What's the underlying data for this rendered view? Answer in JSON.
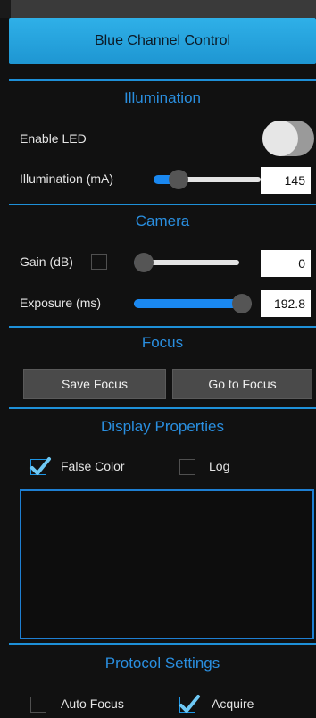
{
  "header": {
    "title": "Blue Channel Control"
  },
  "illumination": {
    "section_title": "Illumination",
    "enable_led_label": "Enable LED",
    "enable_led_on": false,
    "illumination_label": "Illumination (mA)",
    "illumination_value": "145",
    "illumination_slider_fraction": 0.23
  },
  "camera": {
    "section_title": "Camera",
    "gain_label": "Gain (dB)",
    "gain_checked": false,
    "gain_value": "0",
    "gain_slider_fraction": 0.0,
    "exposure_label": "Exposure (ms)",
    "exposure_value": "192.8",
    "exposure_slider_fraction": 1.0
  },
  "focus": {
    "section_title": "Focus",
    "save_focus_label": "Save Focus",
    "go_to_focus_label": "Go to Focus"
  },
  "display": {
    "section_title": "Display Properties",
    "false_color_label": "False Color",
    "false_color_checked": true,
    "log_label": "Log",
    "log_checked": false
  },
  "protocol": {
    "section_title": "Protocol Settings",
    "auto_focus_label": "Auto Focus",
    "auto_focus_checked": false,
    "acquire_label": "Acquire",
    "acquire_checked": true
  },
  "colors": {
    "accent": "#1e90d8",
    "header_button": "#2aa8e4",
    "slider_fill": "#1a88f0",
    "background": "#111111"
  }
}
